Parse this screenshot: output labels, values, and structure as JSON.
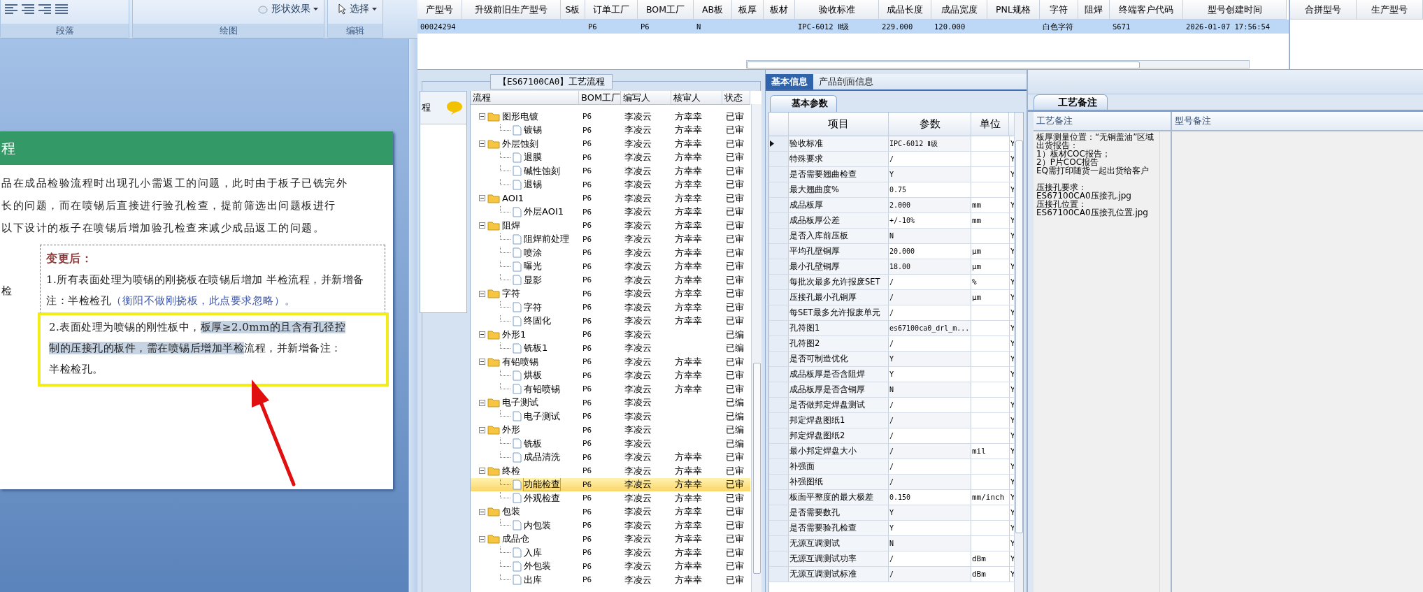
{
  "word": {
    "ribbon": {
      "groups": [
        {
          "label": "段落"
        },
        {
          "label": "绘图",
          "tools": [
            {
              "kind": "effects",
              "label": "形状效果"
            }
          ]
        },
        {
          "label": "编辑",
          "tools": [
            {
              "kind": "select",
              "label": "选择"
            }
          ]
        }
      ]
    },
    "document": {
      "heading": "程",
      "lines": [
        "品在成品检验流程时出现孔小需返工的问题，此时由于板子已铣完外",
        "长的问题，而在喷锡后直接进行验孔检查，提前筛选出问题板进行",
        "以下设计的板子在喷锡后增加验孔检查来减少成品返工的问题。"
      ],
      "side_label": "检",
      "textbox": {
        "title": "变更后：",
        "item1": {
          "text": "1.所有表面处理为喷锡的刚挠板在喷锡后增加 半检流程，并新增备注：半检检孔",
          "note": "（衡阳不做刚挠板，此点要求忽略）。"
        },
        "item2": [
          [
            {
              "text": "2.表面处理为喷锡的刚性板中，",
              "selected": false
            },
            {
              "text": "板厚≥2.0mm的且含有孔径控",
              "selected": true
            }
          ],
          [
            {
              "text": "制的压接孔的板件，需在喷锡后增加半检",
              "selected": true
            },
            {
              "text": "流程，并新增备注：",
              "selected": false
            }
          ],
          [
            {
              "text": "半检检孔。",
              "selected": false
            }
          ]
        ]
      }
    }
  },
  "top_grid": {
    "row_selected": true,
    "columns": [
      {
        "label": "产型号",
        "value": "00024294"
      },
      {
        "label": "升级前旧生产型号"
      },
      {
        "label": "S板"
      },
      {
        "label": "订单工厂",
        "value": "P6"
      },
      {
        "label": "BOM工厂",
        "value": "P6"
      },
      {
        "label": "AB板",
        "value": "N"
      },
      {
        "label": "板厚"
      },
      {
        "label": "板材"
      },
      {
        "label": "验收标准",
        "value": "IPC-6012 Ⅱ级"
      },
      {
        "label": "成品长度",
        "value": "229.000"
      },
      {
        "label": "成品宽度",
        "value": "120.000"
      },
      {
        "label": "PNL规格"
      },
      {
        "label": "字符",
        "value": "白色字符"
      },
      {
        "label": "阻焊"
      },
      {
        "label": "终端客户代码",
        "value": "S671"
      },
      {
        "label": "型号创建时间",
        "value": "2026-01-07 17:56:54"
      }
    ],
    "side_columns": [
      "合拼型号",
      "生产型号"
    ]
  },
  "process": {
    "title": "【ES67100CA0】工艺流程",
    "side_label": "程",
    "columns": [
      "流程",
      "BOM工厂",
      "编写人",
      "核审人",
      "状态"
    ],
    "nodes": [
      {
        "name": "图形电镀",
        "bom": "P6",
        "writer": "李凌云",
        "reviewer": "方幸幸",
        "status": "已审",
        "selected": false,
        "expanded": true,
        "children": [
          {
            "name": "镀锡",
            "bom": "P6",
            "writer": "李凌云",
            "reviewer": "方幸幸",
            "status": "已审",
            "selected": false
          }
        ]
      },
      {
        "name": "外层蚀刻",
        "bom": "P6",
        "writer": "李凌云",
        "reviewer": "方幸幸",
        "status": "已审",
        "selected": false,
        "expanded": true,
        "children": [
          {
            "name": "退膜",
            "bom": "P6",
            "writer": "李凌云",
            "reviewer": "方幸幸",
            "status": "已审",
            "selected": false
          },
          {
            "name": "碱性蚀刻",
            "bom": "P6",
            "writer": "李凌云",
            "reviewer": "方幸幸",
            "status": "已审",
            "selected": false
          },
          {
            "name": "退锡",
            "bom": "P6",
            "writer": "李凌云",
            "reviewer": "方幸幸",
            "status": "已审",
            "selected": false
          }
        ]
      },
      {
        "name": "AOI1",
        "bom": "P6",
        "writer": "李凌云",
        "reviewer": "方幸幸",
        "status": "已审",
        "selected": false,
        "expanded": true,
        "children": [
          {
            "name": "外层AOI1",
            "bom": "P6",
            "writer": "李凌云",
            "reviewer": "方幸幸",
            "status": "已审",
            "selected": false
          }
        ]
      },
      {
        "name": "阻焊",
        "bom": "P6",
        "writer": "李凌云",
        "reviewer": "方幸幸",
        "status": "已审",
        "selected": false,
        "expanded": true,
        "children": [
          {
            "name": "阻焊前处理",
            "bom": "P6",
            "writer": "李凌云",
            "reviewer": "方幸幸",
            "status": "已审",
            "selected": false
          },
          {
            "name": "喷涂",
            "bom": "P6",
            "writer": "李凌云",
            "reviewer": "方幸幸",
            "status": "已审",
            "selected": false
          },
          {
            "name": "曝光",
            "bom": "P6",
            "writer": "李凌云",
            "reviewer": "方幸幸",
            "status": "已审",
            "selected": false
          },
          {
            "name": "显影",
            "bom": "P6",
            "writer": "李凌云",
            "reviewer": "方幸幸",
            "status": "已审",
            "selected": false
          }
        ]
      },
      {
        "name": "字符",
        "bom": "P6",
        "writer": "李凌云",
        "reviewer": "方幸幸",
        "status": "已审",
        "selected": false,
        "expanded": true,
        "children": [
          {
            "name": "字符",
            "bom": "P6",
            "writer": "李凌云",
            "reviewer": "方幸幸",
            "status": "已审",
            "selected": false
          },
          {
            "name": "终固化",
            "bom": "P6",
            "writer": "李凌云",
            "reviewer": "方幸幸",
            "status": "已审",
            "selected": false
          }
        ]
      },
      {
        "name": "外形1",
        "bom": "P6",
        "writer": "李凌云",
        "status": "已编",
        "selected": false,
        "expanded": true,
        "children": [
          {
            "name": "铣板1",
            "bom": "P6",
            "writer": "李凌云",
            "status": "已编",
            "selected": false
          }
        ]
      },
      {
        "name": "有铅喷锡",
        "bom": "P6",
        "writer": "李凌云",
        "reviewer": "方幸幸",
        "status": "已审",
        "selected": false,
        "expanded": true,
        "children": [
          {
            "name": "烘板",
            "bom": "P6",
            "writer": "李凌云",
            "reviewer": "方幸幸",
            "status": "已审",
            "selected": false
          },
          {
            "name": "有铅喷锡",
            "bom": "P6",
            "writer": "李凌云",
            "reviewer": "方幸幸",
            "status": "已审",
            "selected": false
          }
        ]
      },
      {
        "name": "电子测试",
        "bom": "P6",
        "writer": "李凌云",
        "status": "已编",
        "selected": false,
        "expanded": true,
        "children": [
          {
            "name": "电子测试",
            "bom": "P6",
            "writer": "李凌云",
            "status": "已编",
            "selected": false
          }
        ]
      },
      {
        "name": "外形",
        "bom": "P6",
        "writer": "李凌云",
        "status": "已编",
        "selected": false,
        "expanded": true,
        "children": [
          {
            "name": "铣板",
            "bom": "P6",
            "writer": "李凌云",
            "status": "已编",
            "selected": false
          },
          {
            "name": "成品清洗",
            "bom": "P6",
            "writer": "李凌云",
            "reviewer": "方幸幸",
            "status": "已审",
            "selected": false
          }
        ]
      },
      {
        "name": "终检",
        "bom": "P6",
        "writer": "李凌云",
        "reviewer": "方幸幸",
        "status": "已审",
        "selected": false,
        "expanded": true,
        "children": [
          {
            "name": "功能检查",
            "bom": "P6",
            "writer": "李凌云",
            "reviewer": "方幸幸",
            "status": "已审",
            "selected": true
          },
          {
            "name": "外观检查",
            "bom": "P6",
            "writer": "李凌云",
            "reviewer": "方幸幸",
            "status": "已审",
            "selected": false
          }
        ]
      },
      {
        "name": "包装",
        "bom": "P6",
        "writer": "李凌云",
        "reviewer": "方幸幸",
        "status": "已审",
        "selected": false,
        "expanded": true,
        "children": [
          {
            "name": "内包装",
            "bom": "P6",
            "writer": "李凌云",
            "reviewer": "方幸幸",
            "status": "已审",
            "selected": false
          }
        ]
      },
      {
        "name": "成品仓",
        "bom": "P6",
        "writer": "李凌云",
        "reviewer": "方幸幸",
        "status": "已审",
        "selected": false,
        "expanded": true,
        "children": [
          {
            "name": "入库",
            "bom": "P6",
            "writer": "李凌云",
            "reviewer": "方幸幸",
            "status": "已审",
            "selected": false
          },
          {
            "name": "外包装",
            "bom": "P6",
            "writer": "李凌云",
            "reviewer": "方幸幸",
            "status": "已审",
            "selected": false
          },
          {
            "name": "出库",
            "bom": "P6",
            "writer": "李凌云",
            "reviewer": "方幸幸",
            "status": "已审",
            "selected": false
          }
        ]
      }
    ]
  },
  "params": {
    "tabs": [
      {
        "label": "基本信息",
        "selected": true
      },
      {
        "label": "产品剖面信息",
        "selected": false
      }
    ],
    "subtabs": [
      {
        "label": "基本参数",
        "selected": true
      }
    ],
    "columns": [
      "项目",
      "参数",
      "单位"
    ],
    "rows": [
      {
        "item": "验收标准",
        "value": "IPC-6012 Ⅱ级",
        "column_4": "Y",
        "selected": true
      },
      {
        "item": "特殊要求",
        "value": "/",
        "column_4": "Y",
        "selected": false
      },
      {
        "item": "是否需要翘曲检查",
        "value": "Y",
        "column_4": "Y",
        "selected": false
      },
      {
        "item": "最大翘曲度%",
        "value": "0.75",
        "column_4": "Y",
        "selected": false
      },
      {
        "item": "成品板厚",
        "value": "2.000",
        "unit": "mm",
        "column_4": "Y",
        "selected": false
      },
      {
        "item": "成品板厚公差",
        "value": "+/-10%",
        "unit": "mm",
        "column_4": "Y",
        "selected": false
      },
      {
        "item": "是否入库前压板",
        "value": "N",
        "column_4": "Y",
        "selected": false
      },
      {
        "item": "平均孔壁铜厚",
        "value": "20.000",
        "unit": "μm",
        "column_4": "Y",
        "selected": false
      },
      {
        "item": "最小孔壁铜厚",
        "value": "18.00",
        "unit": "μm",
        "column_4": "Y",
        "selected": false
      },
      {
        "item": "每批次最多允许报废SET",
        "value": "/",
        "unit": "%",
        "column_4": "Y",
        "selected": false
      },
      {
        "item": "压接孔最小孔铜厚",
        "value": "/",
        "unit": "μm",
        "column_4": "Y",
        "selected": false
      },
      {
        "item": "每SET最多允许报废单元",
        "value": "/",
        "column_4": "Y",
        "selected": false
      },
      {
        "item": "孔符图1",
        "value": "es67100ca0_drl_m...",
        "column_4": "Y",
        "selected": false
      },
      {
        "item": "孔符图2",
        "value": "/",
        "column_4": "Y",
        "selected": false
      },
      {
        "item": "是否可制造优化",
        "value": "Y",
        "column_4": "Y",
        "selected": false
      },
      {
        "item": "成品板厚是否含阻焊",
        "value": "Y",
        "column_4": "Y",
        "selected": false
      },
      {
        "item": "成品板厚是否含铜厚",
        "value": "N",
        "column_4": "Y",
        "selected": false
      },
      {
        "item": "是否做邦定焊盘测试",
        "value": "/",
        "column_4": "Y",
        "selected": false
      },
      {
        "item": "邦定焊盘图纸1",
        "value": "/",
        "column_4": "Y",
        "selected": false
      },
      {
        "item": "邦定焊盘图纸2",
        "value": "/",
        "column_4": "Y",
        "selected": false
      },
      {
        "item": "最小邦定焊盘大小",
        "value": "/",
        "unit": "mil",
        "column_4": "Y",
        "selected": false
      },
      {
        "item": "补强面",
        "value": "/",
        "column_4": "Y",
        "selected": false
      },
      {
        "item": "补强图纸",
        "value": "/",
        "column_4": "Y",
        "selected": false
      },
      {
        "item": "板面平整度的最大极差",
        "value": "0.150",
        "unit": "mm/inch",
        "column_4": "Y",
        "selected": false
      },
      {
        "item": "是否需要数孔",
        "value": "Y",
        "column_4": "Y",
        "selected": false
      },
      {
        "item": "是否需要验孔检查",
        "value": "Y",
        "column_4": "Y",
        "selected": false
      },
      {
        "item": "无源互调测试",
        "value": "N",
        "column_4": "Y",
        "selected": false
      },
      {
        "item": "无源互调测试功率",
        "value": "/",
        "unit": "dBm",
        "column_4": "Y",
        "selected": false
      },
      {
        "item": "无源互调测试标准",
        "value": "/",
        "unit": "dBm",
        "column_4": "Y",
        "selected": false
      }
    ]
  },
  "notes": {
    "tabs": [
      {
        "label": "工艺备注",
        "selected": true
      }
    ],
    "columns": [
      "工艺备注",
      "型号备注"
    ],
    "paragraphs": [
      [
        "板厚测量位置：“无铜盖油”区域",
        "出货报告：",
        "1）板材COC报告；",
        "2）P片COC报告",
        "EQ需打印随货一起出货给客户"
      ],
      [
        "压接孔要求：",
        "ES67100CA0压接孔.jpg",
        "压接孔位置：",
        "ES67100CA0压接孔位置.jpg"
      ]
    ]
  }
}
